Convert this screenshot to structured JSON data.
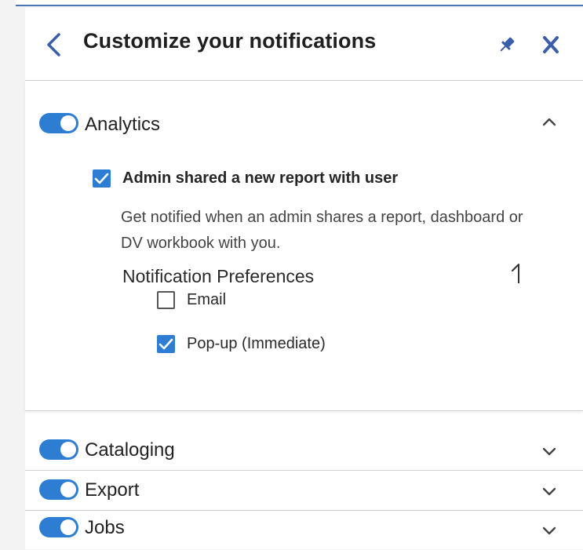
{
  "panel": {
    "title": "Customize your notifications",
    "icons": {
      "back": "chevron-left-icon",
      "pin": "pin-icon",
      "close": "close-icon"
    }
  },
  "sections": {
    "analytics": {
      "label": "Analytics",
      "enabled": true,
      "expanded": true,
      "notification": {
        "title": "Admin shared a new report with user",
        "checked": true,
        "description": "Get notified when an admin shares a report, dashboard or DV workbook with you.",
        "preferences_heading": "Notification Preferences",
        "options": [
          {
            "label": "Email",
            "checked": false
          },
          {
            "label": "Pop-up (Immediate)",
            "checked": true
          }
        ]
      }
    },
    "cataloging": {
      "label": "Cataloging",
      "enabled": true,
      "expanded": false
    },
    "export": {
      "label": "Export",
      "enabled": true,
      "expanded": false
    },
    "jobs": {
      "label": "Jobs",
      "enabled": true,
      "expanded": false
    }
  },
  "colors": {
    "accent": "#2d7dd2",
    "icon_blue": "#3a5fa8"
  }
}
